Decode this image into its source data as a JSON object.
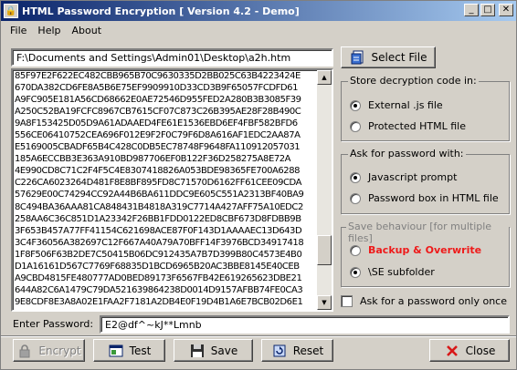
{
  "window": {
    "title": "HTML Password Encryption [ Version 4.2 - Demo]"
  },
  "menu": [
    "File",
    "Help",
    "About"
  ],
  "file_path": "F:\\Documents and Settings\\Admin01\\Desktop\\a2h.htm",
  "select_file_label": "Select File",
  "code_lines": [
    "85F97E2F622EC482CBB965B70C9630335D2BB025C63B4223424E",
    "670DA382CD6FE8A5B6E75EF9909910D33CD3B9F65057FCDFD61",
    "A9FC905E181A56CD68662E0AE72546D955FED2A280B3B3085F39",
    "A250C52BA19FCFC8967CB7615CF07C873C26B395AE28F28B490C",
    "9A8F153425D05D9A61ADAAED4FE61E1536EBD6EF4FBF582BFD6",
    "556CE06410752CEA696F012E9F2F0C79F6D8A616AF1EDC2AA87A",
    "E5169005CBADF65B4C428C0DB5EC78748F9648FA110912057031",
    "185A6ECCBB3E363A910BD987706EF0B122F36D258275A8E72A",
    "4E990CD8C71C2F4F5C4E8307418826A053BDE98365FE700A6288",
    "C226CA6023264D481F8E8BF895FD8C71570D6162FF61CEE09CDA",
    "57629E00C74294CC92A44B6BA611DDC9E605C551A2313BF40BA9",
    "8C494BA36AAA81CA848431B4818A319C7714A427AFF75A10EDC2",
    "258AA6C36C851D1A23342F26BB1FDD0122ED8CBF673D8FDBB9B",
    "3F653B457A77FF41154C621698ACE87F0F143D1AAAAEC13D643D",
    "3C4F36056A382697C12F667A40A79A70BFF14F3976BCD34917418",
    "1F8F506F63B2DE7C50415B06DC912435A7B7D399B80C4573E4B0",
    "D1A16161D567C7769F68835D1BCD6965B20AC3BBE8145E40CEB",
    "A9CBD4815FE480777AD0BED89173F6567FB42E619265623DBE21",
    "644A82C6A1479C79DA521639864238D0014D9157AFBB74FE0CA3",
    "9E8CDF8E3A8A02E1FAA2F7181A2DB4E0F19D4B1A6E7BCB02D6E1"
  ],
  "store_group": {
    "title": "Store decryption code in:",
    "options": [
      {
        "label": "External .js file",
        "selected": true
      },
      {
        "label": "Protected HTML file",
        "selected": false
      }
    ]
  },
  "ask_group": {
    "title": "Ask for password with:",
    "options": [
      {
        "label": "Javascript prompt",
        "selected": true
      },
      {
        "label": "Password box in HTML file",
        "selected": false
      }
    ]
  },
  "save_group": {
    "title": "Save behaviour [for multiple files]",
    "options": [
      {
        "label": "Backup & Overwrite",
        "selected": false
      },
      {
        "label": "\\SE subfolder",
        "selected": true
      }
    ]
  },
  "ask_once_label": "Ask for a password only once",
  "ask_once_checked": false,
  "password": {
    "label": "Enter Password:",
    "value": "E2@df^~kJ**Lmnb"
  },
  "buttons": {
    "encrypt": "Encrypt",
    "test": "Test",
    "save": "Save",
    "reset": "Reset",
    "close": "Close"
  },
  "colors": {
    "title_start": "#0a246a",
    "title_end": "#a6caf0",
    "warning": "#ee1a1a",
    "face": "#d4d0c8"
  }
}
